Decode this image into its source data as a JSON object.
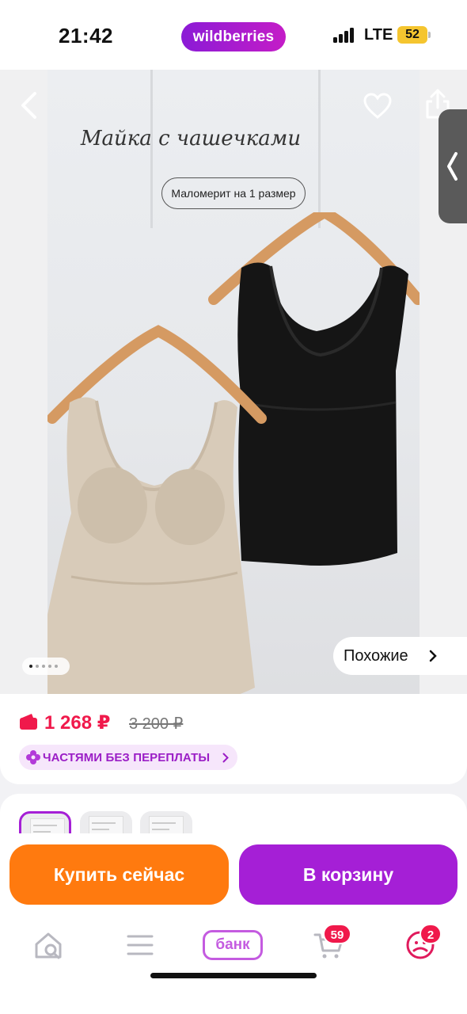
{
  "status_bar": {
    "time": "21:42",
    "brand": "wildberries",
    "network": "LTE",
    "battery": "52"
  },
  "product_photo": {
    "title": "Майка с чашечками",
    "size_note": "Маломерит на 1 размер",
    "similar_label": "Похожие",
    "slides_total": 5,
    "active_slide": 1
  },
  "price": {
    "current": "1 268 ₽",
    "old": "3 200 ₽",
    "installment_label": "ЧАСТЯМИ БЕЗ ПЕРЕПЛАТЫ",
    "accent_color": "#f0194b"
  },
  "thumbnails": {
    "count": 3,
    "selected_index": 0
  },
  "actions": {
    "buy_now": "Купить сейчас",
    "add_to_cart": "В корзину",
    "buy_color": "#ff7a0f",
    "cart_color": "#a51fd6"
  },
  "bottom_nav": {
    "items": [
      {
        "icon": "home-search-icon"
      },
      {
        "icon": "menu-icon"
      },
      {
        "label": "банк"
      },
      {
        "icon": "cart-icon",
        "badge": "59"
      },
      {
        "icon": "profile-icon",
        "badge": "2"
      }
    ]
  }
}
